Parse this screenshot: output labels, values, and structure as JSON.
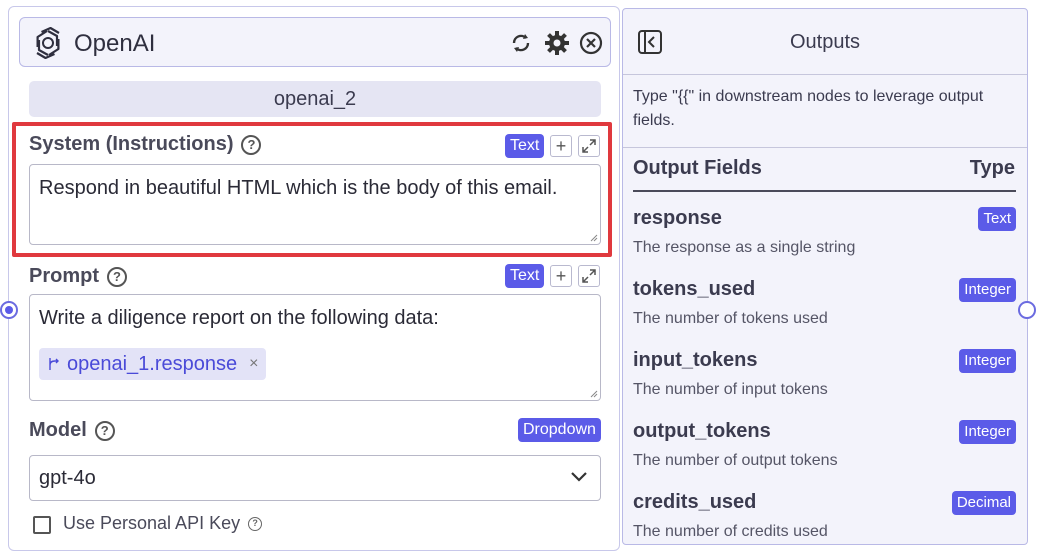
{
  "node": {
    "title": "OpenAI",
    "name": "openai_2",
    "header_icons": [
      "refresh-icon",
      "gear-icon",
      "close-circle-icon"
    ]
  },
  "system_field": {
    "label": "System (Instructions)",
    "badge": "Text",
    "value": "Respond in beautiful HTML which is the body of this email."
  },
  "prompt_field": {
    "label": "Prompt",
    "badge": "Text",
    "value": "Write a diligence report on the following data:",
    "chip": "openai_1.response",
    "chip_close": "×"
  },
  "model_field": {
    "label": "Model",
    "badge": "Dropdown",
    "selected": "gpt-4o"
  },
  "personal_key": {
    "label": "Use Personal API Key",
    "checked": false
  },
  "outputs": {
    "title": "Outputs",
    "description": "Type \"{{\" in downstream nodes to leverage output fields.",
    "col_fields": "Output Fields",
    "col_type": "Type",
    "fields": [
      {
        "name": "response",
        "type": "Text",
        "desc": "The response as a single string"
      },
      {
        "name": "tokens_used",
        "type": "Integer",
        "desc": "The number of tokens used"
      },
      {
        "name": "input_tokens",
        "type": "Integer",
        "desc": "The number of input tokens"
      },
      {
        "name": "output_tokens",
        "type": "Integer",
        "desc": "The number of output tokens"
      },
      {
        "name": "credits_used",
        "type": "Decimal",
        "desc": "The number of credits used"
      }
    ]
  },
  "colors": {
    "accent": "#5b5be8",
    "highlight": "#e0393e",
    "panel_bg": "#f3f3fb"
  }
}
